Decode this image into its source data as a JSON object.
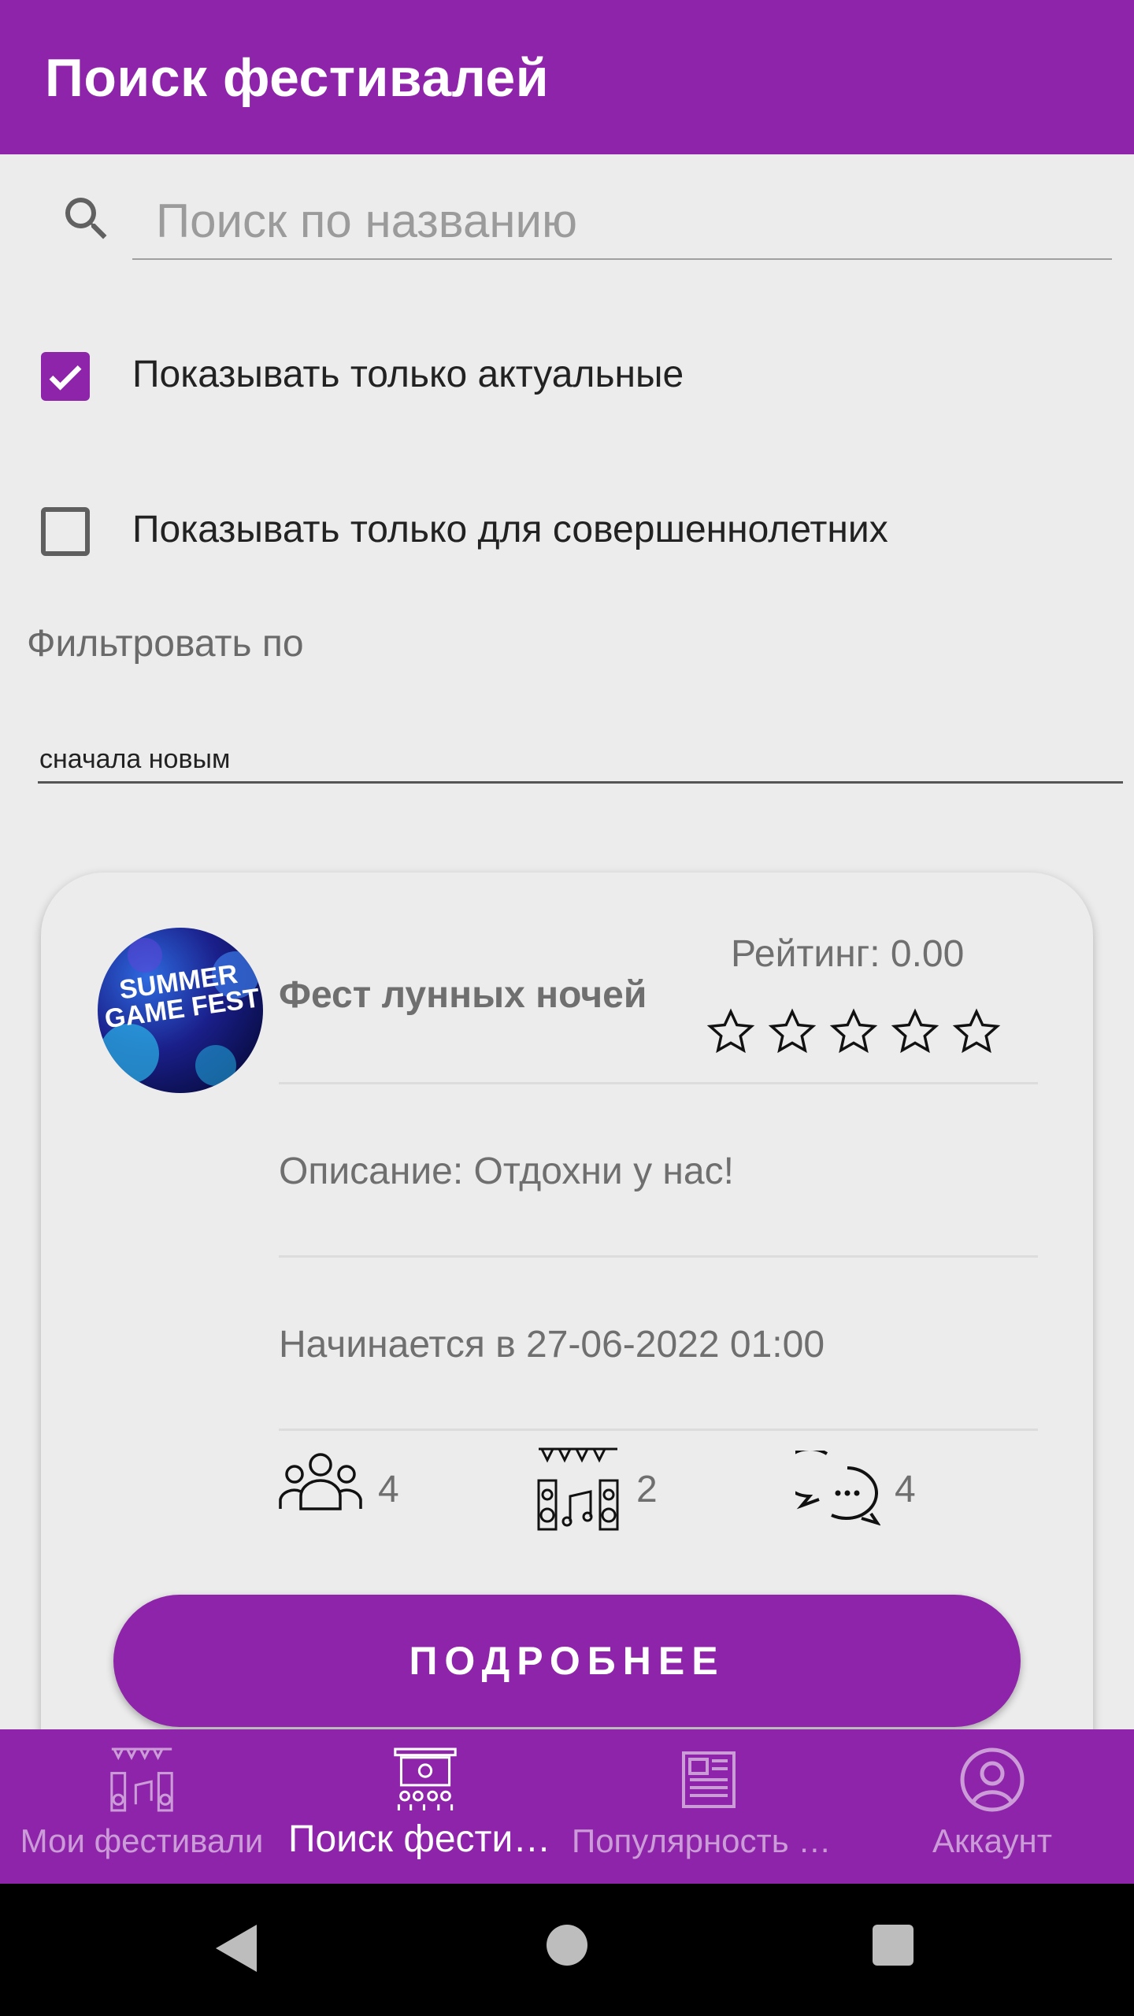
{
  "appbar": {
    "title": "Поиск фестивалей"
  },
  "search": {
    "placeholder": "Поиск по названию",
    "value": ""
  },
  "filters": {
    "only_actual": {
      "label": "Показывать только актуальные",
      "checked": true
    },
    "only_adult": {
      "label": "Показывать только для совершеннолетних",
      "checked": false
    },
    "sort_label": "Фильтровать по",
    "sort_value": "сначала новым"
  },
  "festival_card": {
    "logo_text": "SUMMER GAME FEST",
    "name": "Фест лунных ночей",
    "rating_text": "Рейтинг: 0.00",
    "rating_value": 0,
    "rating_max": 5,
    "description": "Описание: Отдохни у нас!",
    "start": "Начинается в 27-06-2022 01:00",
    "participants_count": "4",
    "events_count": "2",
    "comments_count": "4",
    "more_button": "ПОДРОБНЕЕ"
  },
  "bottom_nav": {
    "items": [
      {
        "label": "Мои фестивали",
        "icon": "stage-speakers-icon",
        "active": false
      },
      {
        "label": "Поиск фестив...",
        "icon": "concert-stage-icon",
        "active": true
      },
      {
        "label": "Популярность ф...",
        "icon": "news-icon",
        "active": false
      },
      {
        "label": "Аккаунт",
        "icon": "account-icon",
        "active": false
      }
    ]
  },
  "colors": {
    "primary": "#8E24AA",
    "background": "#ECECEC"
  }
}
